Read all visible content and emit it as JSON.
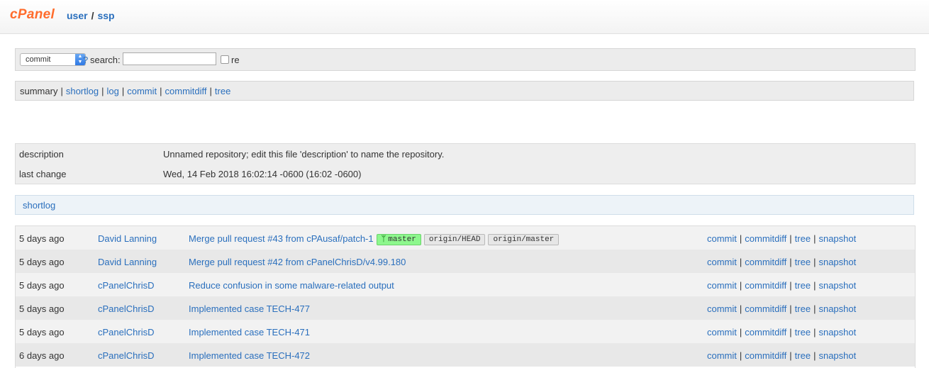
{
  "header": {
    "logo": "cPanel",
    "crumb_user": "user",
    "crumb_sep": "/",
    "crumb_repo": "ssp"
  },
  "search": {
    "select_value": "commit",
    "help": "?",
    "label": "search:",
    "input_value": "",
    "re_label": "re"
  },
  "nav": {
    "current": "summary",
    "links": [
      "shortlog",
      "log",
      "commit",
      "commitdiff",
      "tree"
    ],
    "separator": "|"
  },
  "project": {
    "description_key": "description",
    "description_value": "Unnamed repository; edit this file 'description' to name the repository.",
    "last_change_key": "last change",
    "last_change_value": "Wed, 14 Feb 2018 16:02:14 -0600 (16:02 -0600)"
  },
  "shortlog": {
    "header": "shortlog",
    "action_labels": [
      "commit",
      "commitdiff",
      "tree",
      "snapshot"
    ],
    "rows": [
      {
        "age": "5 days ago",
        "author": "David Lanning",
        "title": "Merge pull request #43 from cPAusaf/patch-1",
        "refs": {
          "head": "master",
          "tags": [
            "origin/HEAD",
            "origin/master"
          ]
        }
      },
      {
        "age": "5 days ago",
        "author": "David Lanning",
        "title": "Merge pull request #42 from cPanelChrisD/v4.99.180"
      },
      {
        "age": "5 days ago",
        "author": "cPanelChrisD",
        "title": "Reduce confusion in some malware-related output"
      },
      {
        "age": "5 days ago",
        "author": "cPanelChrisD",
        "title": "Implemented case TECH-477"
      },
      {
        "age": "5 days ago",
        "author": "cPanelChrisD",
        "title": "Implemented case TECH-471"
      },
      {
        "age": "6 days ago",
        "author": "cPanelChrisD",
        "title": "Implemented case TECH-472"
      }
    ]
  }
}
